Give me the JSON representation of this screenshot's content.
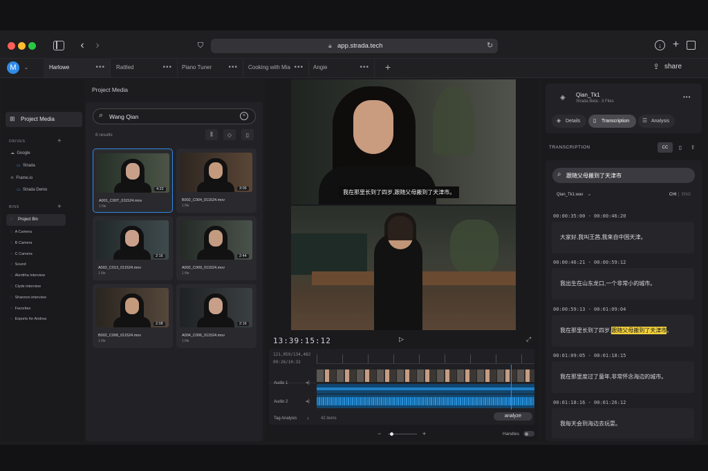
{
  "browser": {
    "url": "app.strada.tech",
    "share_label": "share",
    "avatar_letter": "M"
  },
  "tabs": [
    {
      "label": "Harlowe"
    },
    {
      "label": "Rattled"
    },
    {
      "label": "Piano Tuner"
    },
    {
      "label": "Cooking with Mia"
    },
    {
      "label": "Angie"
    }
  ],
  "sidebar": {
    "project_media": "Project Media",
    "drives_header": "DRIVES",
    "drives": [
      "Google",
      "Strada",
      "Frame.io",
      "Strada Demo"
    ],
    "bins_header": "BINS",
    "bins": [
      "Project Bin",
      "A Camera",
      "B Camera",
      "C Camera",
      "Sound",
      "Alenttha interview",
      "Clyde interview",
      "Shannon interview",
      "Favorites",
      "Exports for Andrea"
    ]
  },
  "media": {
    "title": "Project Media",
    "search_value": "Wang Qian",
    "results": "6 results",
    "clips": [
      {
        "name": "A001_C00T_011524.mov",
        "sub": "1 file",
        "duration": "4:22"
      },
      {
        "name": "B002_C004_011524.mov",
        "sub": "1 file",
        "duration": "3:06"
      },
      {
        "name": "A002_C013_011524.mov",
        "sub": "1 file",
        "duration": "2:16"
      },
      {
        "name": "A002_C009_011524.mov",
        "sub": "1 file",
        "duration": "2:44"
      },
      {
        "name": "B002_C008_011524.mov",
        "sub": "1 file",
        "duration": "2:08"
      },
      {
        "name": "A004_C006_011524.mov",
        "sub": "1 file",
        "duration": "2:16"
      }
    ]
  },
  "player": {
    "subtitle": "我在那里长到了四岁,跟随父母搬到了天津市。",
    "timecode": "13:39:15:12",
    "tc_small_1": "121,059/134,482",
    "tc_small_2": "09:26/10:32",
    "track_audio1": "Audio 1",
    "track_audio2": "Audio 2",
    "tag_analysis": "Tag Analysis",
    "items_count": "42 items",
    "analyze_label": "analyze",
    "handles_label": "Handles"
  },
  "right": {
    "clip_title": "Qian_Tk1",
    "clip_sub": "Strada Beta - 3 Files",
    "tab_details": "Details",
    "tab_transcription": "Transcription",
    "tab_analysis": "Analysis",
    "section_title": "TRANSCRIPTION",
    "cc_label": "CC",
    "search_value": "跟随父母搬到了天津市",
    "file_select": "Qian_Tk1.wav",
    "lang_chi": "CHI",
    "lang_eng": "ENG",
    "entries": [
      {
        "time": "00:00:35:00 - 00:00:46:20",
        "text": "大家好,我叫王茜,我来自中国天津。"
      },
      {
        "time": "00:00:46:21 - 00:00:59:12",
        "text": "我出生在山东龙口,一个非常小的城市。"
      },
      {
        "time": "00:00:59:13 - 00:01:09:04",
        "text_before": "我在那里长到了四岁,",
        "highlight": "跟随父母搬到了天津市",
        "text_after": "。"
      },
      {
        "time": "00:01:09:05 - 00:01:18:15",
        "text": "我在那里度过了童年,非常怀念海边的城市。"
      },
      {
        "time": "00:01:18:16 - 00:01:26:12",
        "text": "我每天会到海边去玩耍。"
      }
    ]
  },
  "colors": {
    "accent": "#2f8be8",
    "highlight": "#f2d13a",
    "audio": "#1f7fc4"
  }
}
